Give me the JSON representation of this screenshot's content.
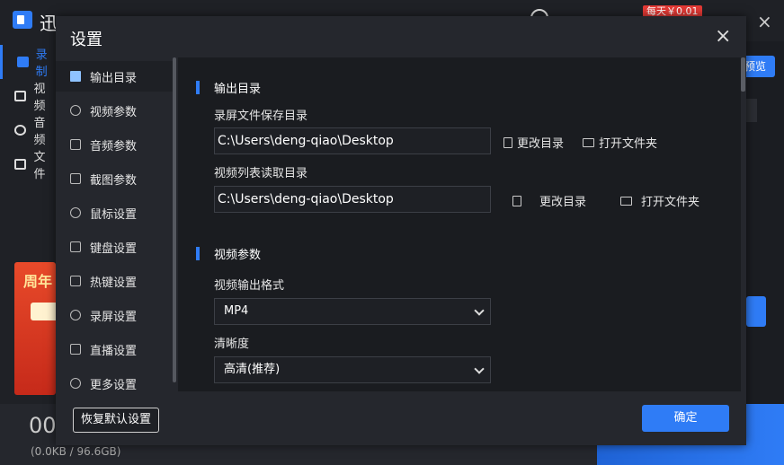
{
  "app": {
    "title": "迅",
    "promo_badge": "每天￥0.01",
    "preview_label": "预览",
    "sidebar": [
      "录制",
      "视频",
      "音频",
      "文件"
    ],
    "promo_card_text": "周年",
    "bottom_time": "00",
    "bottom_size": "(0.0KB / 96.6GB)"
  },
  "dialog": {
    "title": "设置",
    "close_label": "×",
    "nav": [
      {
        "label": "输出目录",
        "icon": "folder-icon"
      },
      {
        "label": "视频参数",
        "icon": "video-icon"
      },
      {
        "label": "音频参数",
        "icon": "audio-icon"
      },
      {
        "label": "截图参数",
        "icon": "screenshot-icon"
      },
      {
        "label": "鼠标设置",
        "icon": "mouse-icon"
      },
      {
        "label": "键盘设置",
        "icon": "keyboard-icon"
      },
      {
        "label": "热键设置",
        "icon": "hotkey-icon"
      },
      {
        "label": "录屏设置",
        "icon": "record-icon"
      },
      {
        "label": "直播设置",
        "icon": "live-icon"
      },
      {
        "label": "更多设置",
        "icon": "more-icon"
      }
    ],
    "output": {
      "section_title": "输出目录",
      "save_label": "录屏文件保存目录",
      "save_path": "C:\\Users\\deng-qiao\\Desktop",
      "change_dir": "更改目录",
      "open_folder": "打开文件夹",
      "read_label": "视频列表读取目录",
      "read_path": "C:\\Users\\deng-qiao\\Desktop"
    },
    "video": {
      "section_title": "视频参数",
      "format_label": "视频输出格式",
      "format_value": "MP4",
      "quality_label": "清晰度",
      "quality_value": "高清(推荐)"
    },
    "reset_label": "恢复默认设置",
    "ok_label": "确定"
  },
  "colors": {
    "accent": "#2f7cf6",
    "dialog_bg": "#25272d",
    "content_bg": "#1a1c20"
  }
}
